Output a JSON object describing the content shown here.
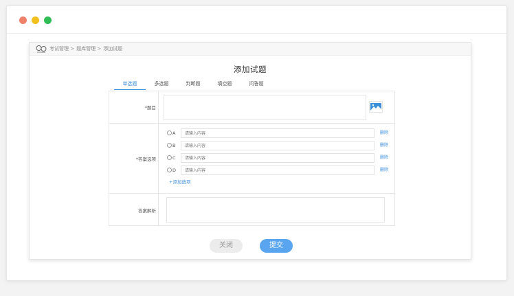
{
  "window": {
    "controls": [
      "close",
      "minimize",
      "maximize"
    ]
  },
  "app": {
    "logo_icon": "logo-icon",
    "breadcrumb": [
      "考试管理 >",
      "题库管理 >",
      "添加试题"
    ]
  },
  "page": {
    "title": "添加试题"
  },
  "tabs": [
    "单选题",
    "多选题",
    "判断题",
    "填空题",
    "问答题"
  ],
  "active_tab": "单选题",
  "form": {
    "question_label": "*题目",
    "image_icon": "image-icon",
    "options_label": "*答案选项",
    "options": [
      {
        "letter": "A",
        "placeholder": "请输入内容",
        "delete": "删除"
      },
      {
        "letter": "B",
        "placeholder": "请输入内容",
        "delete": "删除"
      },
      {
        "letter": "C",
        "placeholder": "请输入内容",
        "delete": "删除"
      },
      {
        "letter": "D",
        "placeholder": "请输入内容",
        "delete": "删除"
      }
    ],
    "add_option": "+添加选项",
    "analysis_label": "答案解析"
  },
  "buttons": {
    "close": "关闭",
    "submit": "提交"
  },
  "colors": {
    "accent": "#3c8ee0",
    "submit": "#5aa5ef",
    "dot_red": "#f0826a",
    "dot_yellow": "#f2c01e",
    "dot_green": "#2fbd55"
  }
}
